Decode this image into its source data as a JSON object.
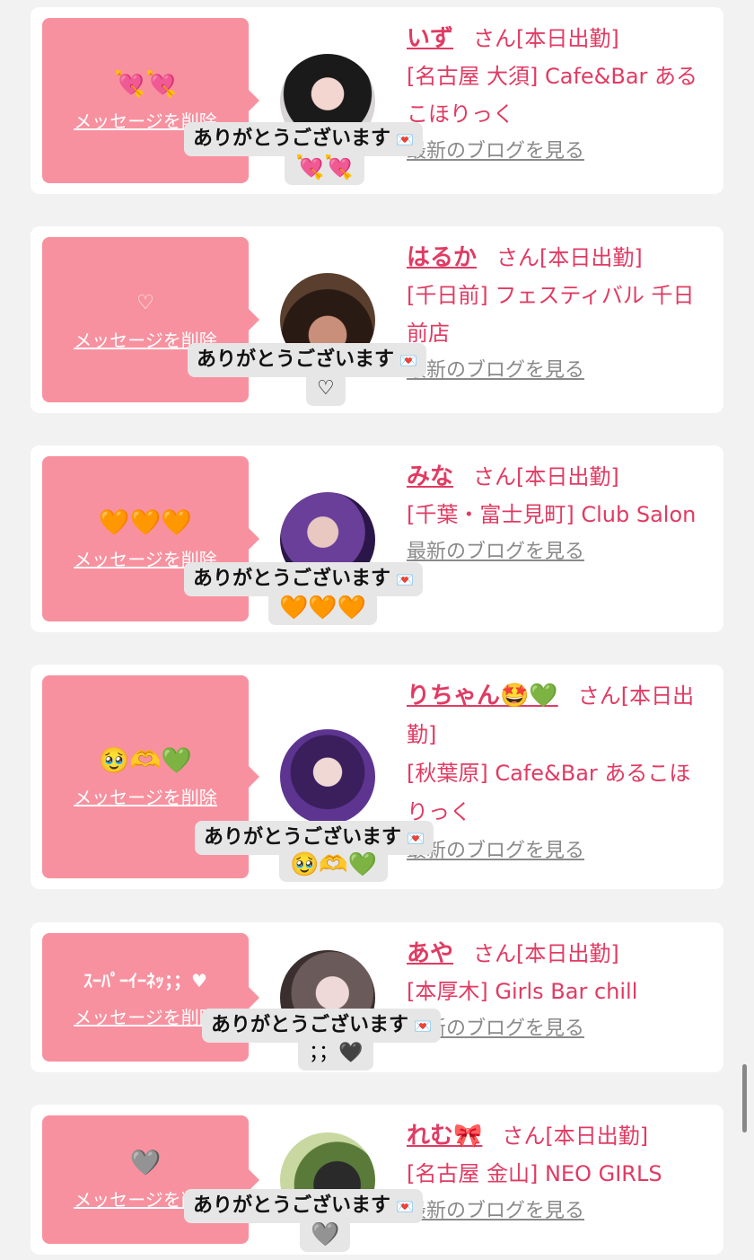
{
  "card_common": {
    "delete_label": "メッセージを削除",
    "thanks_label": "ありがとうございます",
    "envelope_icon": "💌",
    "honorific": "さん[本日出勤]",
    "blog_label": "最新のブログを見る"
  },
  "cards": [
    {
      "message": "💘💘",
      "name": "いず",
      "shop": "[名古屋 大須] Cafe&Bar あるこほりっく",
      "reply": "💘💘"
    },
    {
      "message": "♡",
      "name": "はるか",
      "shop": "[千日前] フェスティバル 千日前店",
      "reply": "♡"
    },
    {
      "message": "🧡🧡🧡",
      "name": "みな",
      "shop": "[千葉・富士見町] Club Salon",
      "reply": "🧡🧡🧡"
    },
    {
      "message": "🥹🫶💚",
      "name": "りちゃん🤩💚",
      "shop": "[秋葉原] Cafe&Bar あるこほりっく",
      "reply": "🥹🫶💚"
    },
    {
      "message": "ｽｰﾊﾟｰｲｰﾈｯ；；♥",
      "name": "あや",
      "shop": "[本厚木] Girls Bar chill",
      "reply": "；；🖤"
    },
    {
      "message": "🩶",
      "name": "れむ🎀",
      "shop": "[名古屋 金山] NEO GIRLS",
      "reply": "🩶"
    }
  ],
  "colors": {
    "accent": "#e03b63",
    "bubble": "#f8919f",
    "background": "#f2f2f2"
  }
}
